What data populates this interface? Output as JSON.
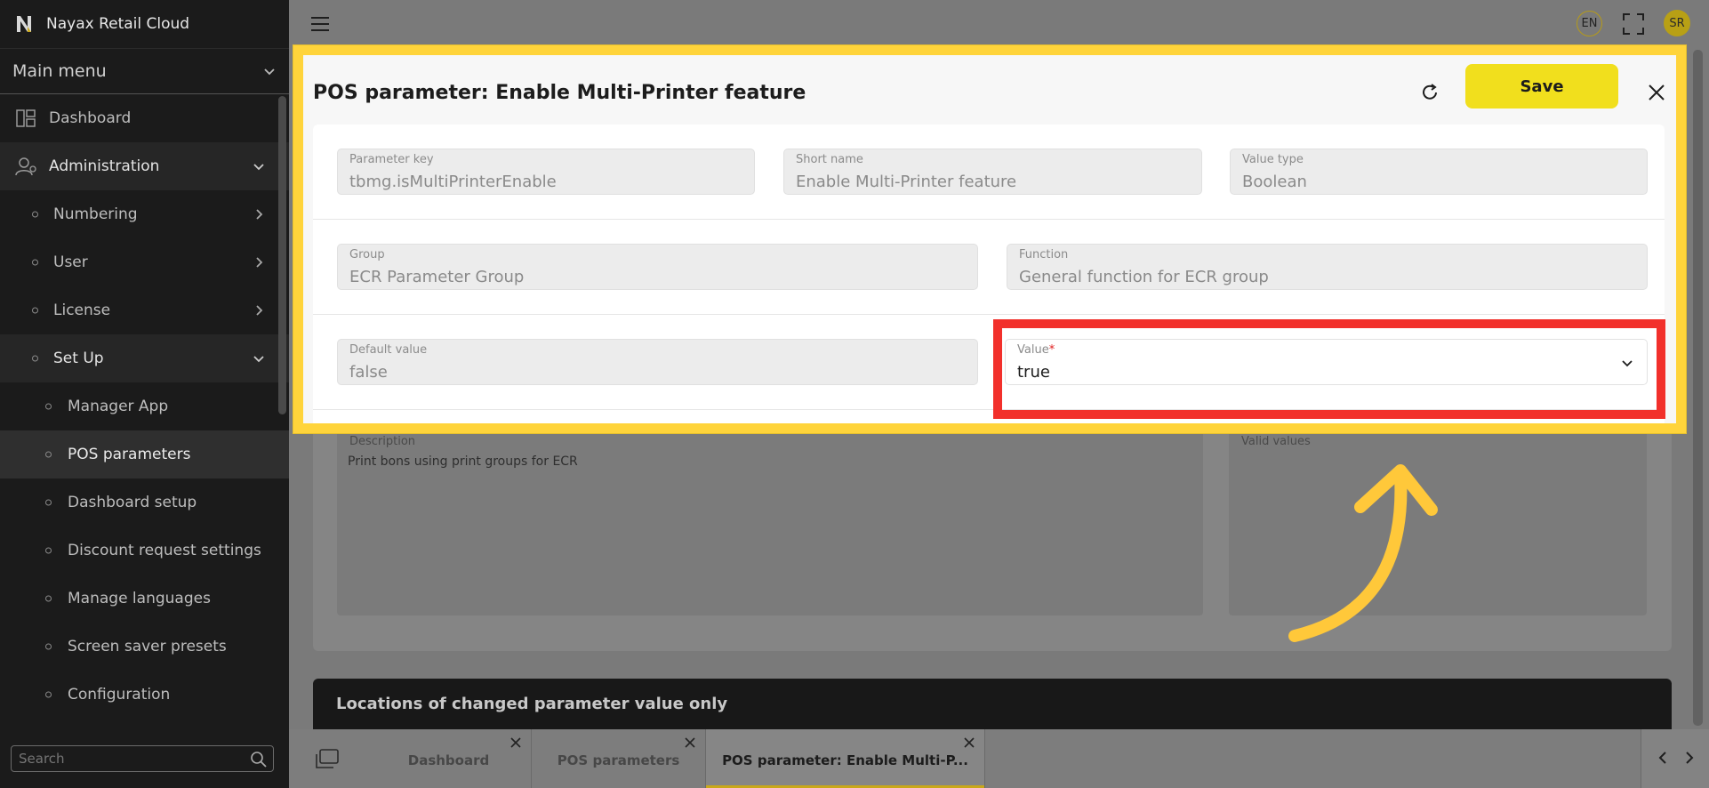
{
  "app": {
    "title": "Nayax Retail Cloud"
  },
  "sidebar": {
    "main_menu_label": "Main menu",
    "items": [
      {
        "label": "Dashboard"
      },
      {
        "label": "Administration"
      },
      {
        "label": "Numbering"
      },
      {
        "label": "User"
      },
      {
        "label": "License"
      },
      {
        "label": "Set Up"
      },
      {
        "label": "Manager App"
      },
      {
        "label": "POS parameters"
      },
      {
        "label": "Dashboard setup"
      },
      {
        "label": "Discount request settings"
      },
      {
        "label": "Manage languages"
      },
      {
        "label": "Screen saver presets"
      },
      {
        "label": "Configuration"
      }
    ],
    "search_placeholder": "Search"
  },
  "topbar": {
    "language": "EN",
    "avatar_initials": "SR"
  },
  "modal": {
    "title": "POS parameter: Enable Multi-Printer feature",
    "save_label": "Save",
    "fields": {
      "parameter_key": {
        "label": "Parameter key",
        "value": "tbmg.isMultiPrinterEnable"
      },
      "short_name": {
        "label": "Short name",
        "value": "Enable Multi-Printer feature"
      },
      "value_type": {
        "label": "Value type",
        "value": "Boolean"
      },
      "group": {
        "label": "Group",
        "value": "ECR Parameter Group"
      },
      "function": {
        "label": "Function",
        "value": "General function for ECR group"
      },
      "default_value": {
        "label": "Default value",
        "value": "false"
      },
      "value": {
        "label": "Value",
        "required_mark": "*",
        "value": "true"
      }
    }
  },
  "background": {
    "description": {
      "label": "Description",
      "value": "Print bons using print groups for ECR"
    },
    "valid_values": {
      "label": "Valid values"
    },
    "locations_title": "Locations of changed parameter value only"
  },
  "tabs": [
    {
      "label": "Dashboard"
    },
    {
      "label": "POS parameters"
    },
    {
      "label": "POS parameter: Enable Multi-P..."
    }
  ],
  "colors": {
    "highlight_yellow": "#ffd43b",
    "highlight_red": "#f2302b",
    "save_button": "#f1df1d"
  }
}
